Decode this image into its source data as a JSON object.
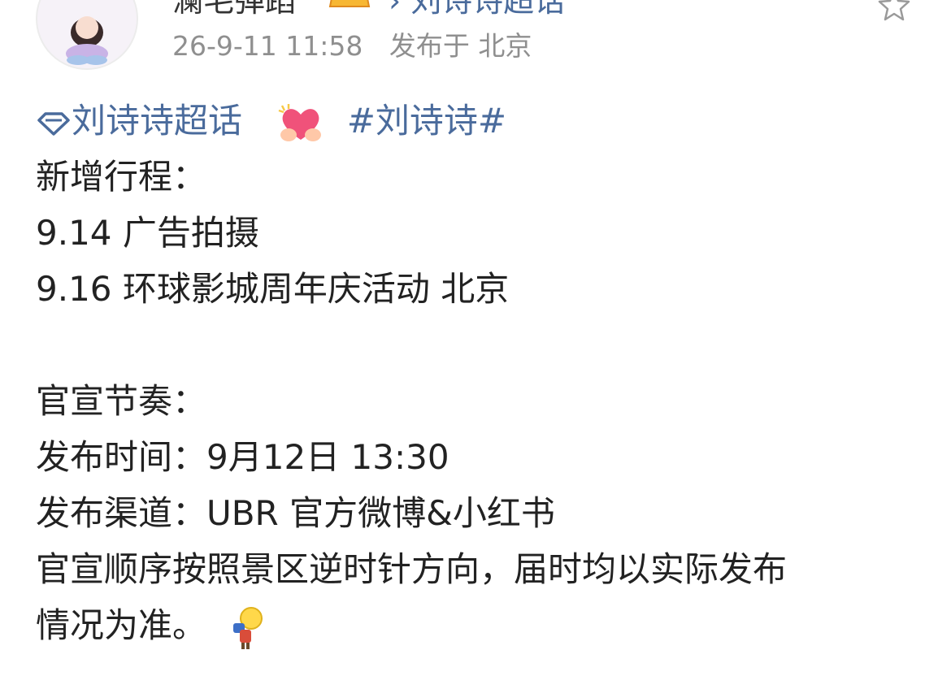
{
  "header": {
    "username": "澜毛弹蹈",
    "topic_label": "刘诗诗超话",
    "arrow": "›",
    "timestamp": "26-9-11 11:58",
    "location": "发布于 北京"
  },
  "post": {
    "supertopic": "刘诗诗超话",
    "hashtag": "#刘诗诗#",
    "lines": {
      "l1": "新增行程：",
      "l2": "9.14 广告拍摄",
      "l3": "9.16 环球影城周年庆活动 北京",
      "l4": "官宣节奏：",
      "l5": "发布时间：9月12日 13:30",
      "l6": "发布渠道：UBR 官方微博&小红书",
      "l7": "官宣顺序按照景区逆时针方向，届时均以实际发布",
      "l8": "情况为准。"
    }
  },
  "icons": {
    "supertopic": "diamond-icon",
    "heart": "heart-hands-emoji",
    "bulb": "lightbulb-person-emoji",
    "favorite": "star-icon"
  },
  "colors": {
    "link": "#4a6b9c",
    "meta": "#8f8f8f",
    "text": "#222222"
  }
}
